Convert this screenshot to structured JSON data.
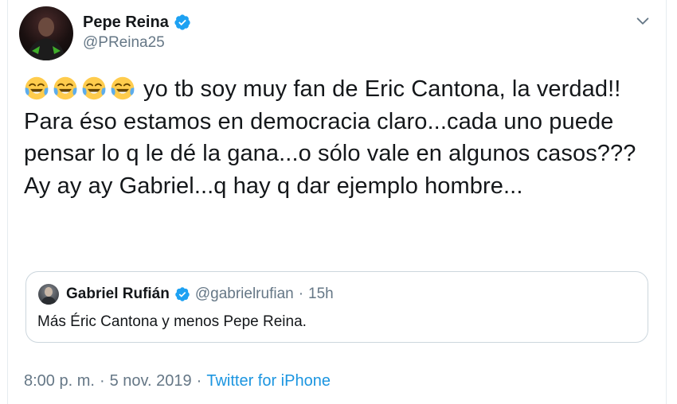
{
  "author": {
    "display_name": "Pepe Reina",
    "handle": "@PReina25",
    "verified": true
  },
  "tweet": {
    "emojis": [
      "face-with-tears-of-joy",
      "face-with-tears-of-joy",
      "face-with-tears-of-joy",
      "face-with-tears-of-joy"
    ],
    "text": "yo tb soy muy fan de Eric Cantona, la verdad!! Para éso estamos en democracia claro...cada uno puede pensar lo q le dé la gana...o sólo vale en algunos casos??? Ay ay ay Gabriel...q hay q dar ejemplo hombre..."
  },
  "quoted_tweet": {
    "display_name": "Gabriel Rufián",
    "handle": "@gabrielrufian",
    "separator": "·",
    "time": "15h",
    "text": "Más Éric Cantona y menos Pepe Reina."
  },
  "meta": {
    "time": "8:00 p. m.",
    "separator1": "·",
    "date": "5 nov. 2019",
    "separator2": "·",
    "source": "Twitter for iPhone"
  },
  "colors": {
    "verified_blue": "#1da1f2",
    "link_blue": "#1b95e0",
    "secondary_text": "#657786",
    "border": "#ccd6dd"
  }
}
